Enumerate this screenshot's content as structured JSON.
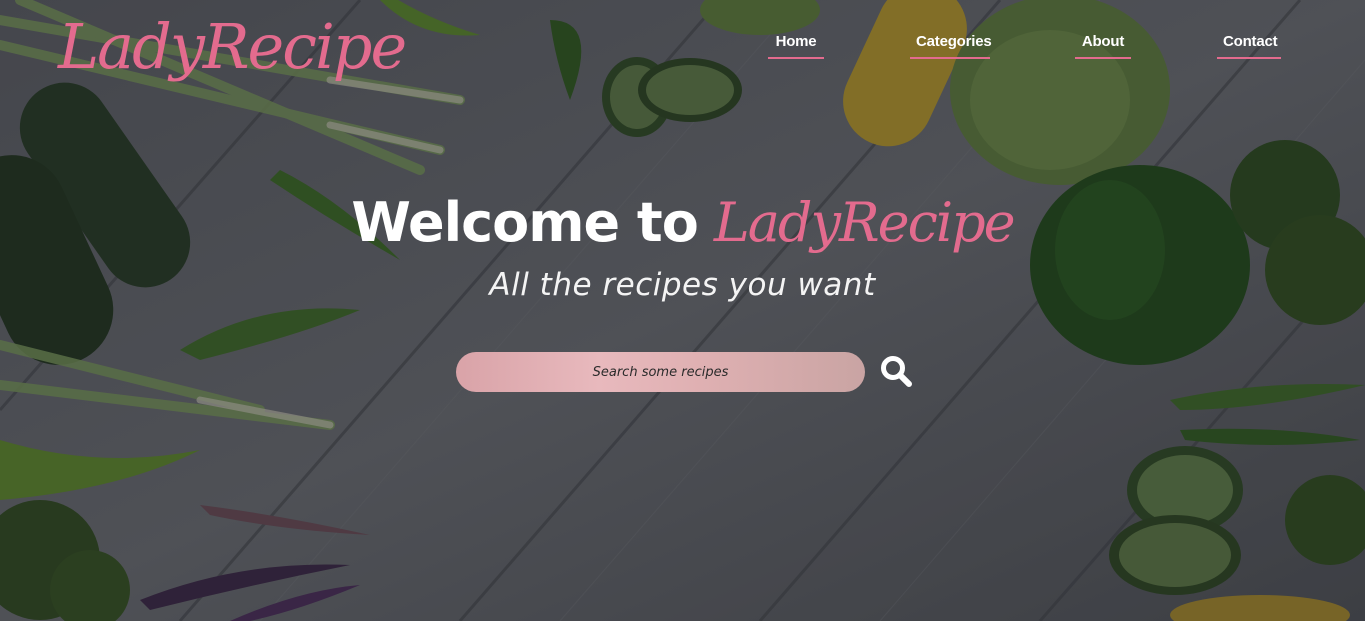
{
  "brand": {
    "logo_text": "LadyRecipe",
    "accent_color": "#e36b8e"
  },
  "nav": {
    "items": [
      {
        "label": "Home"
      },
      {
        "label": "Categories"
      },
      {
        "label": "About"
      },
      {
        "label": "Contact"
      }
    ]
  },
  "hero": {
    "welcome_prefix": "Welcome to",
    "welcome_brand": "LadyRecipe",
    "tagline": "All the recipes you want"
  },
  "search": {
    "placeholder": "Search some recipes",
    "value": "",
    "icon": "search-icon"
  },
  "background": {
    "description_icon": "vegetables-on-wooden-table"
  }
}
